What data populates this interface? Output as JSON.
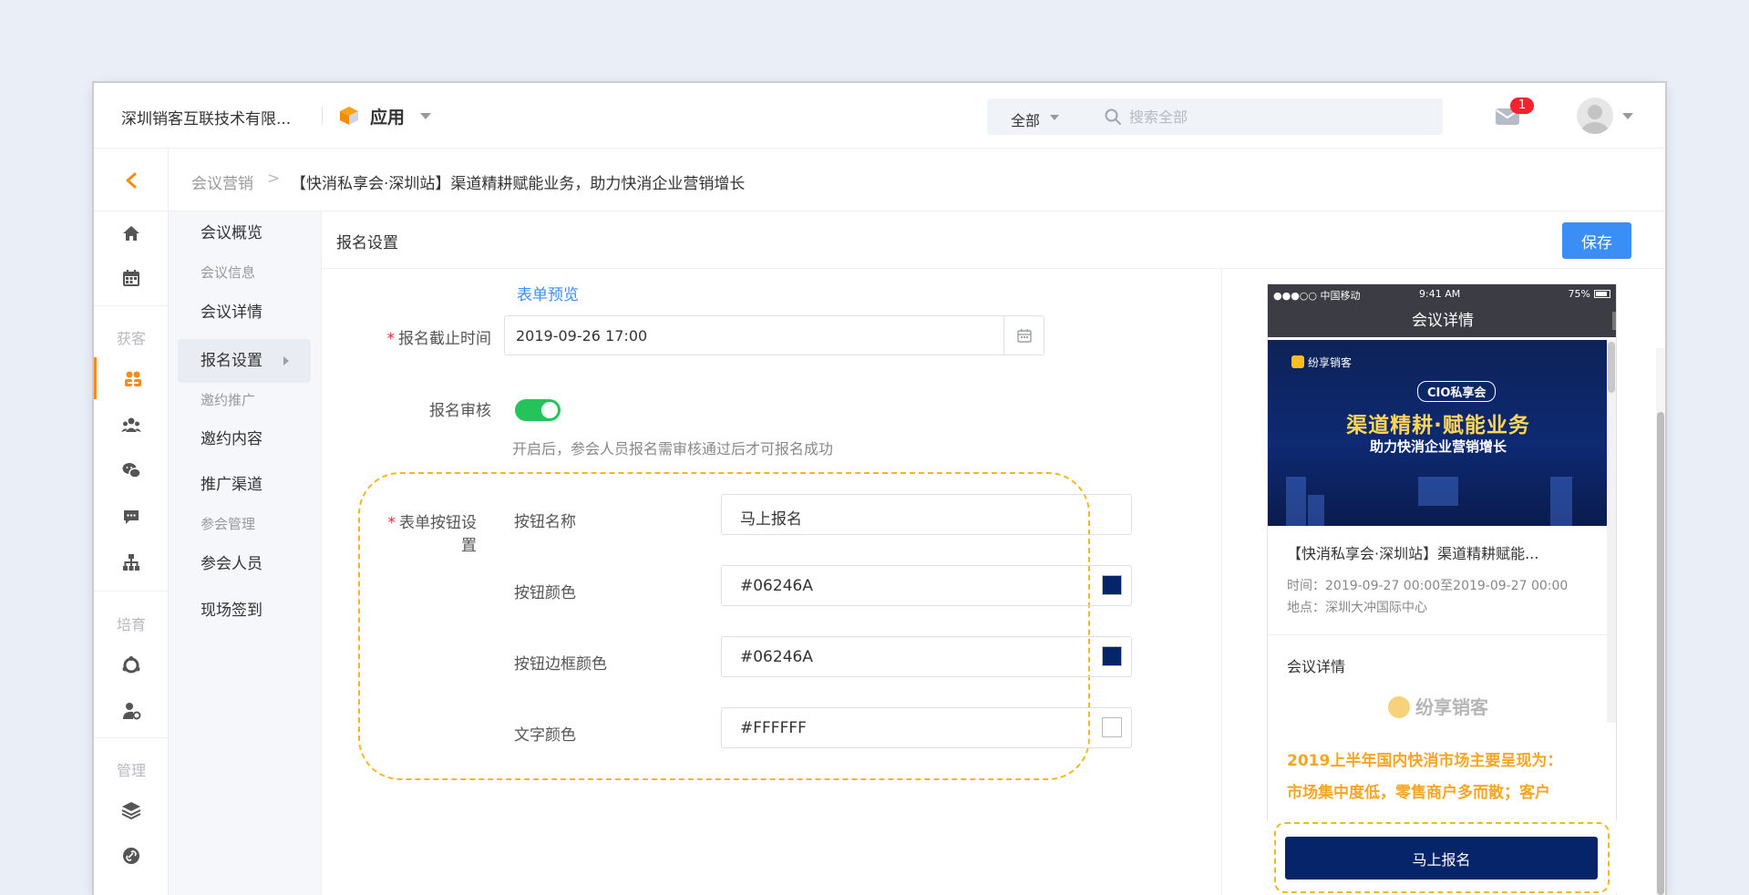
{
  "header": {
    "company": "深圳销客互联技术有限...",
    "app_title": "应用",
    "search_scope": "全部",
    "search_placeholder": "搜索全部",
    "mail_badge": "1"
  },
  "breadcrumb": {
    "root": "会议营销",
    "separator": ">",
    "title": "【快消私享会·深圳站】渠道精耕赋能业务，助力快消企业营销增长"
  },
  "rail": {
    "groups": [
      "获客",
      "培育",
      "管理"
    ],
    "icons": [
      "home-icon",
      "calendar-icon",
      "team-icon",
      "people-icon",
      "wechat-icon",
      "chat-icon",
      "org-icon",
      "circle-icon",
      "user-setting-icon",
      "layers-icon",
      "link-icon"
    ],
    "accent": "#fa8c16"
  },
  "subnav": {
    "items": [
      {
        "label": "会议概览"
      },
      {
        "label": "会议信息"
      },
      {
        "label": "会议详情"
      },
      {
        "label": "报名设置"
      },
      {
        "label": "邀约推广"
      },
      {
        "label": "邀约内容"
      },
      {
        "label": "推广渠道"
      },
      {
        "label": "参会管理"
      },
      {
        "label": "参会人员"
      },
      {
        "label": "现场签到"
      }
    ]
  },
  "content": {
    "title": "报名设置",
    "save_label": "保存",
    "preview_link": "表单预览",
    "deadline_label": "报名截止时间",
    "deadline_value": "2019-09-26 17:00",
    "review_label": "报名审核",
    "review_enabled": true,
    "review_hint": "开启后，参会人员报名需审核通过后才可报名成功",
    "button_section_label": "表单按钮设置",
    "button_rows": [
      {
        "label": "按钮名称",
        "value": "马上报名",
        "swatch": null
      },
      {
        "label": "按钮颜色",
        "value": "#06246A",
        "swatch": "#06246A"
      },
      {
        "label": "按钮边框颜色",
        "value": "#06246A",
        "swatch": "#06246A"
      },
      {
        "label": "文字颜色",
        "value": "#FFFFFF",
        "swatch": "#FFFFFF"
      }
    ]
  },
  "phone": {
    "carrier": "●●●○○ 中国移动",
    "time": "9:41 AM",
    "battery": "75%",
    "nav_title": "会议详情",
    "banner_logo": "纷享销客",
    "banner_badge": "CIO私享会",
    "banner_title": "渠道精耕·赋能业务",
    "banner_subtitle": "助力快消企业营销增长",
    "event_title": "【快消私享会·深圳站】渠道精耕赋能...",
    "event_time": "时间：2019-09-27 00:00至2019-09-27 00:00",
    "event_place": "地点：深圳大冲国际中心",
    "detail_heading": "会议详情",
    "detail_brand": "纷享销客",
    "detail_line1": "2019上半年国内快消市场主要呈现为：",
    "detail_line2": "市场集中度低，零售商户多而散；客户",
    "signup_label": "马上报名"
  }
}
